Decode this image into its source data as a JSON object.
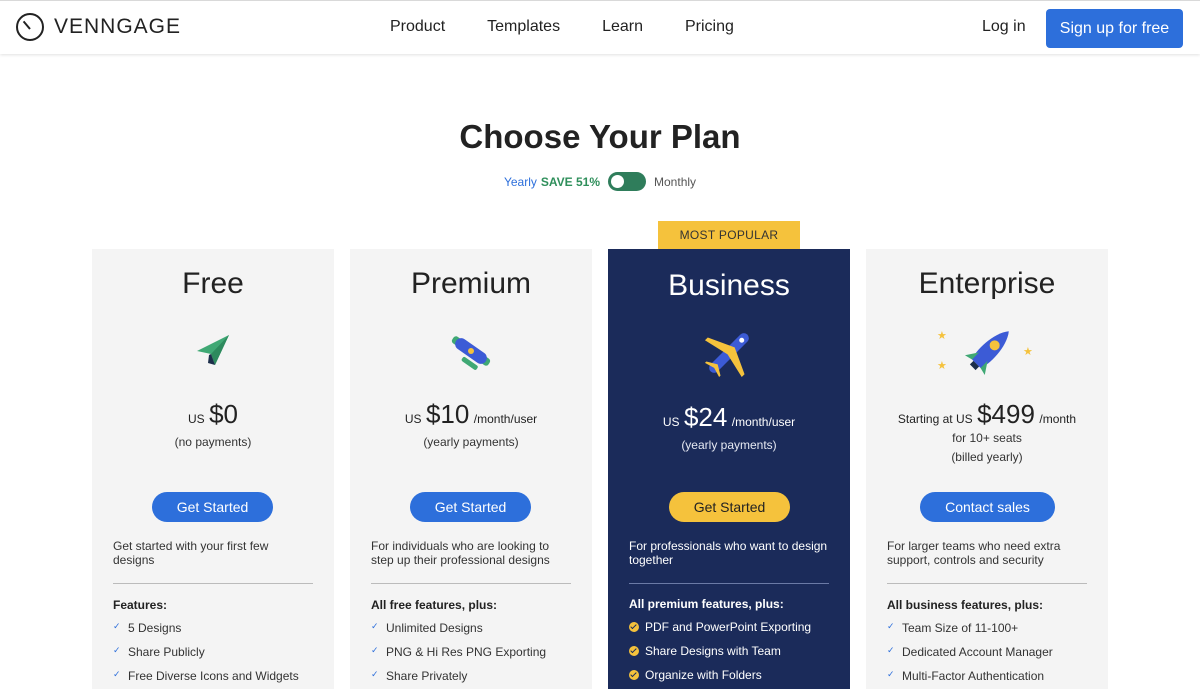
{
  "nav": {
    "brand": "VENNGAGE",
    "links": [
      "Product",
      "Templates",
      "Learn",
      "Pricing"
    ],
    "login": "Log in",
    "signup": "Sign up for free"
  },
  "hero": {
    "title": "Choose Your Plan",
    "yearly": "Yearly",
    "save": "SAVE 51%",
    "monthly": "Monthly"
  },
  "badge": "MOST POPULAR",
  "plans": [
    {
      "name": "Free",
      "icon": "paper-plane-icon",
      "pre": "US",
      "price": "$0",
      "per": "",
      "sub1": "(no payments)",
      "sub2": "",
      "cta": "Get Started",
      "desc": "Get started with your first few designs",
      "feat_head": "Features:",
      "features": [
        "5 Designs",
        "Share Publicly",
        "Free Diverse Icons and Widgets"
      ]
    },
    {
      "name": "Premium",
      "icon": "biplane-icon",
      "pre": "US",
      "price": "$10",
      "per": "/month/user",
      "sub1": "(yearly payments)",
      "sub2": "",
      "cta": "Get Started",
      "desc": "For individuals who are looking to step up their professional designs",
      "feat_head": "All free features, plus:",
      "features": [
        "Unlimited Designs",
        "PNG & Hi Res PNG Exporting",
        "Share Privately"
      ]
    },
    {
      "name": "Business",
      "icon": "airplane-icon",
      "pre": "US",
      "price": "$24",
      "per": "/month/user",
      "sub1": "(yearly payments)",
      "sub2": "",
      "cta": "Get Started",
      "desc": "For professionals who want to design together",
      "feat_head": "All premium features, plus:",
      "features": [
        "PDF and PowerPoint Exporting",
        "Share Designs with Team",
        "Organize with Folders"
      ]
    },
    {
      "name": "Enterprise",
      "icon": "rocket-icon",
      "pre": "Starting at US",
      "price": "$499",
      "per": "/month",
      "sub1": "for 10+ seats",
      "sub2": "(billed yearly)",
      "cta": "Contact sales",
      "desc": "For larger teams who need extra support, controls and security",
      "feat_head": "All business features, plus:",
      "features": [
        "Team Size of 11-100+",
        "Dedicated Account Manager",
        "Multi-Factor Authentication"
      ]
    }
  ],
  "colors": {
    "accent": "#2d6fdb",
    "business_bg": "#1b2b5a",
    "gold": "#f5c23c",
    "toggle": "#2f7d5b"
  }
}
